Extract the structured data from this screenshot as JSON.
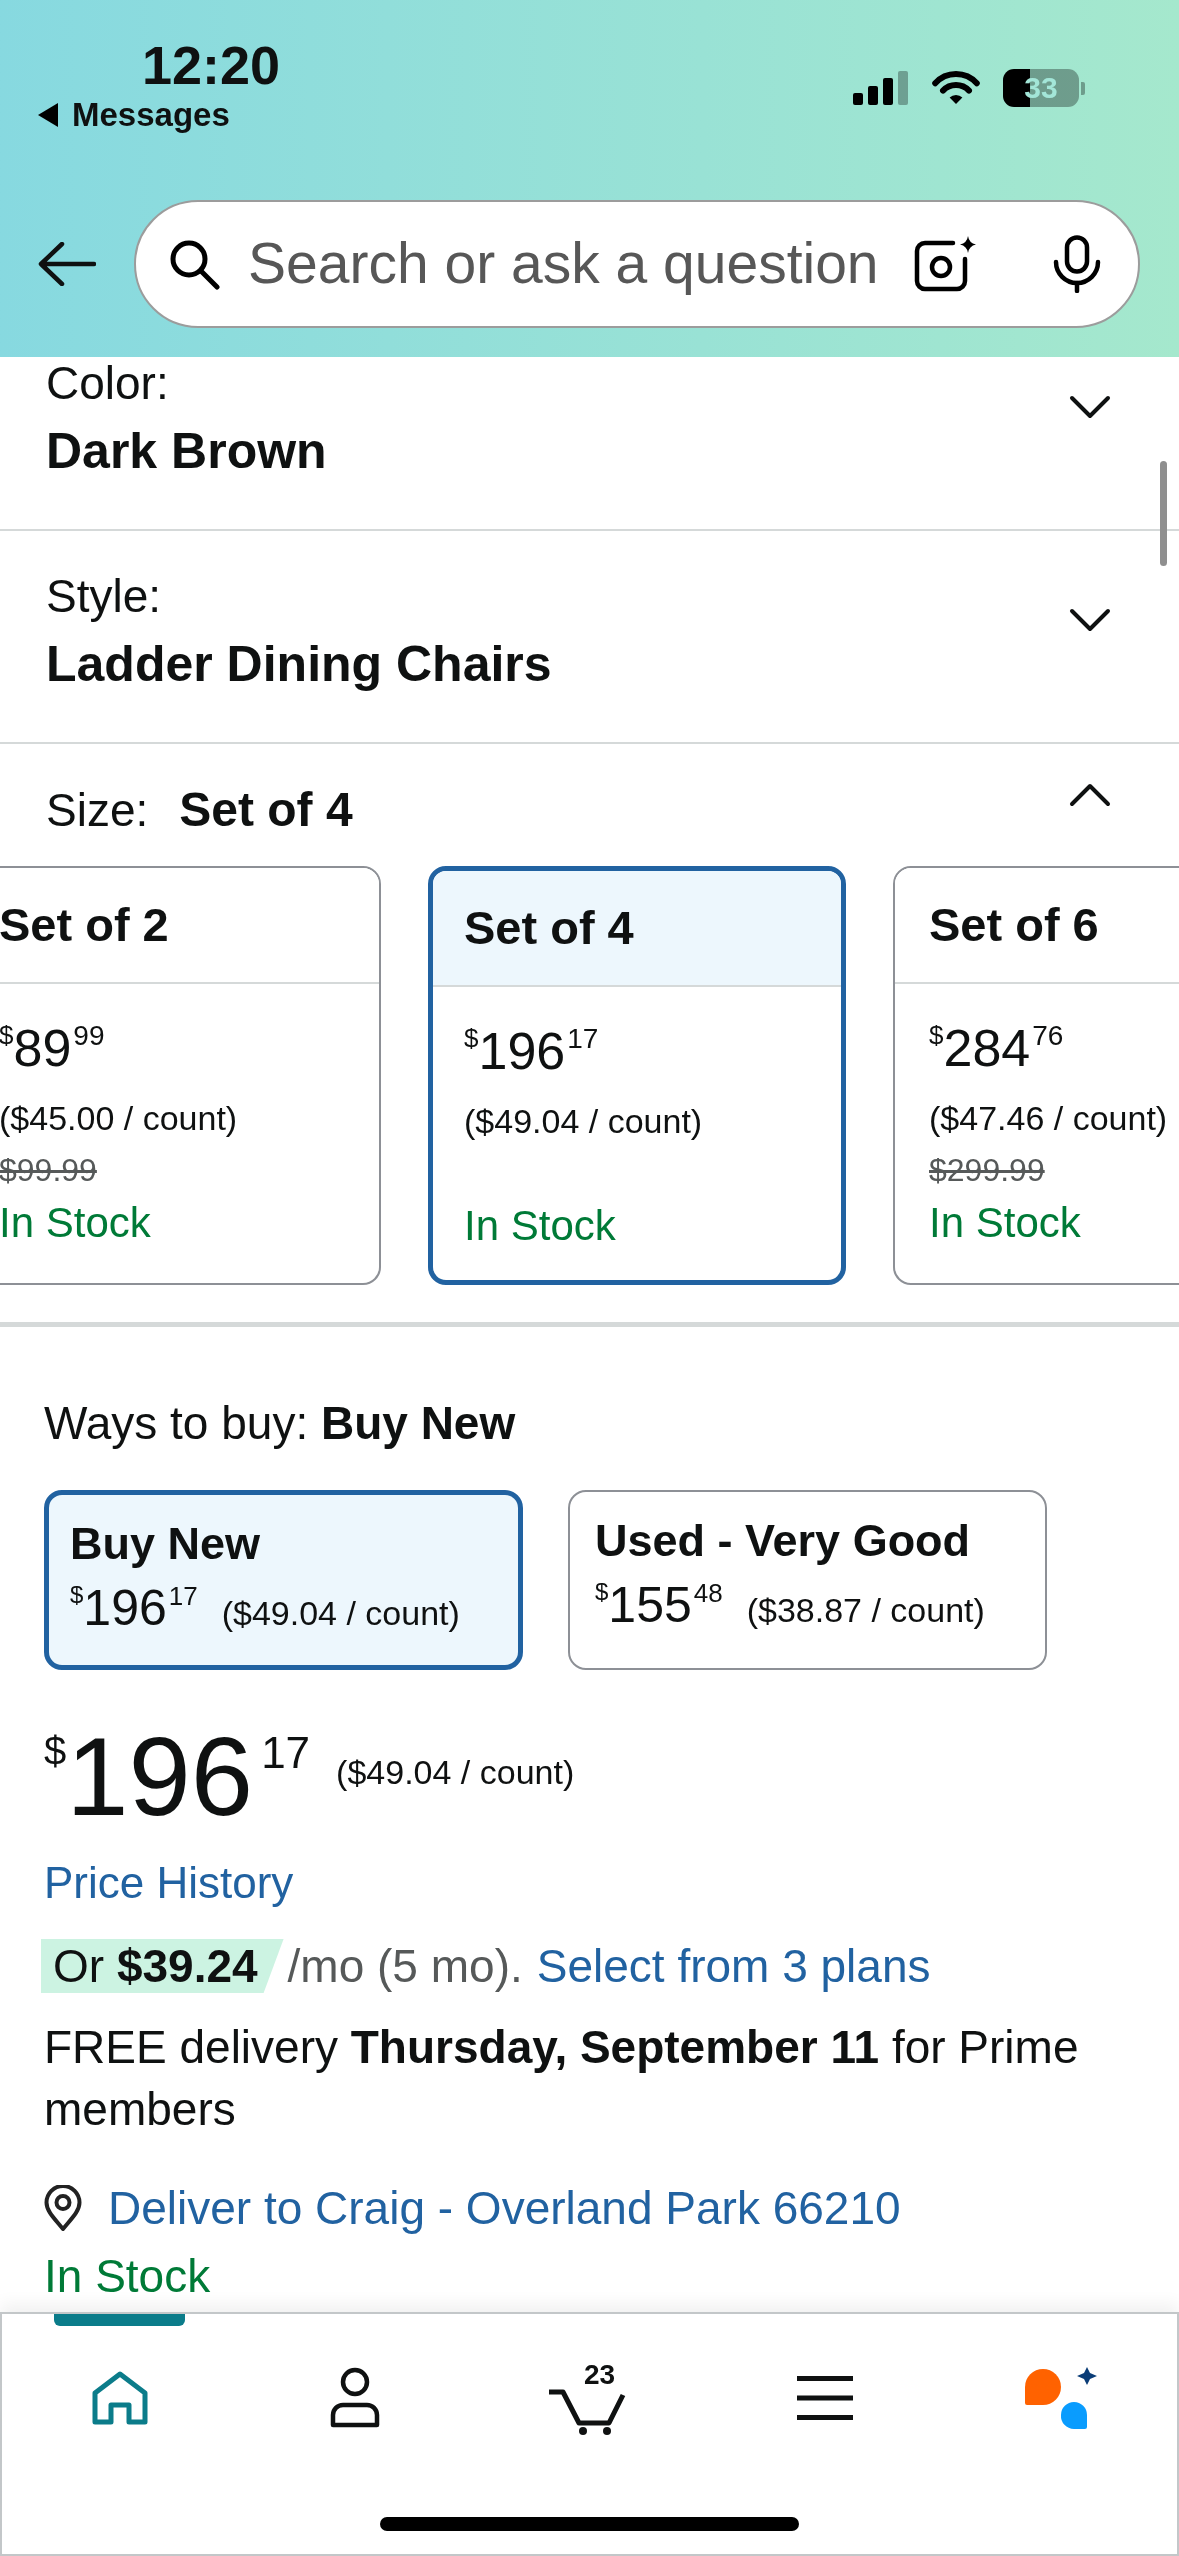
{
  "status_bar": {
    "time": "12:20",
    "back_label": "Messages",
    "battery": "33"
  },
  "search": {
    "placeholder": "Search or ask a question"
  },
  "variations": [
    {
      "label": "Color:",
      "value": "Dark Brown",
      "expanded": false
    },
    {
      "label": "Style:",
      "value": "Ladder Dining Chairs",
      "expanded": false
    },
    {
      "label": "Size:",
      "value": "Set of 4",
      "expanded": true,
      "options": [
        {
          "name": "Set of 2",
          "price": {
            "symbol": "$",
            "whole": "89",
            "fraction": "99"
          },
          "unit_price": "($45.00 / count)",
          "list_price": "$99.99",
          "availability": "In Stock",
          "selected": false
        },
        {
          "name": "Set of 4",
          "price": {
            "symbol": "$",
            "whole": "196",
            "fraction": "17"
          },
          "unit_price": "($49.04 / count)",
          "availability": "In Stock",
          "selected": true
        },
        {
          "name": "Set of 6",
          "price": {
            "symbol": "$",
            "whole": "284",
            "fraction": "76"
          },
          "unit_price": "($47.46 / count)",
          "list_price": "$299.99",
          "availability": "In Stock",
          "selected": false
        }
      ]
    }
  ],
  "ways_to_buy": {
    "label": "Ways to buy: **Buy New**",
    "options": [
      {
        "title": "Buy New",
        "price": {
          "symbol": "$",
          "whole": "196",
          "fraction": "17"
        },
        "unit_price": "($49.04 / count)",
        "selected": true
      },
      {
        "title": "Used - Very Good",
        "price": {
          "symbol": "$",
          "whole": "155",
          "fraction": "48"
        },
        "unit_price": "($38.87 / count)",
        "selected": false
      }
    ]
  },
  "buy_box": {
    "price": {
      "symbol": "$",
      "whole": "196",
      "fraction": "17"
    },
    "unit_price": "($49.04 / count)",
    "price_history_link": "Price History",
    "installment": {
      "badge": "Or **$39.24**",
      "terms": "/mo (5 mo).",
      "link": "Select from 3 plans"
    },
    "delivery": "FREE delivery **Thursday, September 11** for Prime members",
    "deliver_to_link": "Deliver to Craig - Overland Park 66210",
    "availability": "In Stock"
  },
  "tab_bar": [
    {
      "kind": "home",
      "selected": true
    },
    {
      "kind": "account",
      "selected": false
    },
    {
      "kind": "cart",
      "count": "23",
      "selected": false
    },
    {
      "kind": "menu",
      "selected": false
    },
    {
      "kind": "assistant",
      "selected": false
    }
  ]
}
